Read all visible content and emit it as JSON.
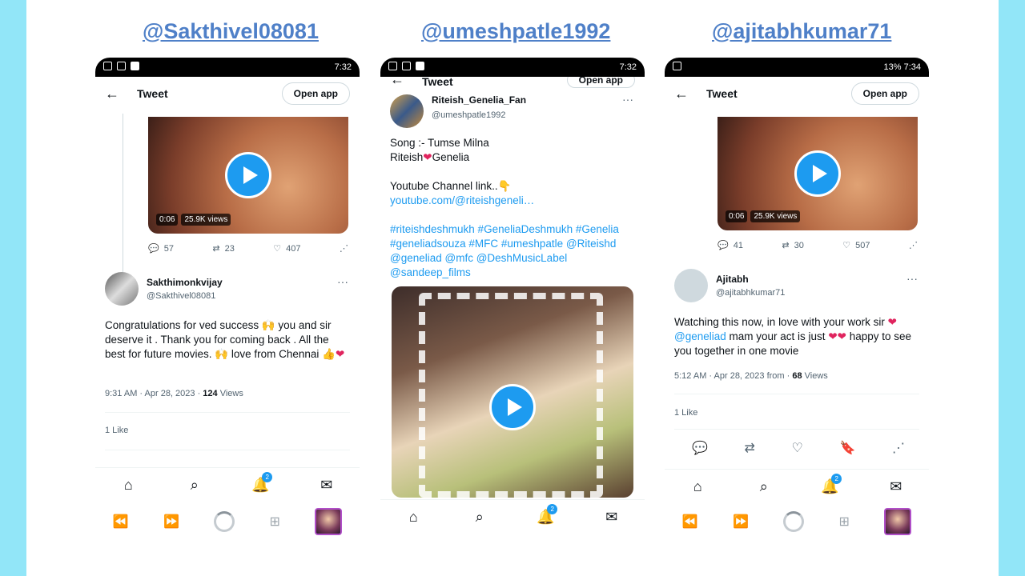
{
  "handles": [
    "@Sakthivel08081",
    "@umeshpatle1992",
    "@ajitabhkumar71"
  ],
  "phone1": {
    "status_time": "7:32",
    "topbar": {
      "title": "Tweet",
      "open_app": "Open app"
    },
    "video": {
      "duration": "0:06",
      "views": "25.9K views"
    },
    "actions": {
      "replies": "57",
      "retweets": "23",
      "likes": "407"
    },
    "reply": {
      "name": "Sakthimonkvijay",
      "handle": "@Sakthivel08081",
      "text": "Congratulations for ved success 🙌 you and sir  deserve it . Thank you for coming back . All the best for future movies. 🙌 love from Chennai 👍",
      "time": "9:31 AM · Apr 28, 2023 · ",
      "views_count": "124",
      "views_label": " Views",
      "likes": "1 Like"
    },
    "nav_badge": "2"
  },
  "phone2": {
    "status_time": "7:32",
    "topbar": {
      "title": "Tweet",
      "open_app": "Open app"
    },
    "post": {
      "name": "Riteish_Genelia_Fan",
      "handle": "@umeshpatle1992",
      "line1": "Song :- Tumse Milna",
      "line2a": "Riteish",
      "line2b": "Genelia",
      "line3": "Youtube Channel link..👇",
      "link": "youtube.com/@riteishgeneli…",
      "tags": "#riteishdeshmukh #GeneliaDeshmukh #Genelia #geneliadsouza #MFC #umeshpatle @Riteishd @geneliad @mfc @DeshMusicLabel @sandeep_films"
    },
    "nav_badge": "2"
  },
  "phone3": {
    "status_time": "7:34",
    "battery": "13%",
    "topbar": {
      "title": "Tweet",
      "open_app": "Open app"
    },
    "video": {
      "duration": "0:06",
      "views": "25.9K views"
    },
    "actions": {
      "replies": "41",
      "retweets": "30",
      "likes": "507"
    },
    "reply": {
      "name": "Ajitabh",
      "handle": "@ajitabhkumar71",
      "text_a": "Watching this now, in love with your work sir",
      "mention": "@geneliad",
      "text_b": " mam your act is just",
      "text_c": "happy to see you together in one movie",
      "time": "5:12 AM · Apr 28, 2023 from  · ",
      "views_count": "68",
      "views_label": " Views",
      "likes": "1 Like"
    },
    "nav_badge": "2"
  },
  "colors": {
    "accent": "#1d9bf0",
    "handle": "#4f80c8",
    "background": "#92e6f8"
  }
}
